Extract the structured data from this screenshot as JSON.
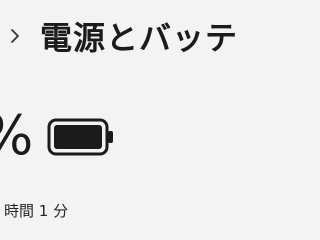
{
  "header": {
    "title": "電源とバッテリー",
    "chevron_icon": "chevron-right-icon"
  },
  "battery": {
    "percent_text": "%",
    "icon": "battery-full-icon",
    "charge_level": 1.0,
    "remaining_time": "時間 1 分"
  },
  "colors": {
    "background": "#f3f3f3",
    "text": "#1b1b1b"
  }
}
